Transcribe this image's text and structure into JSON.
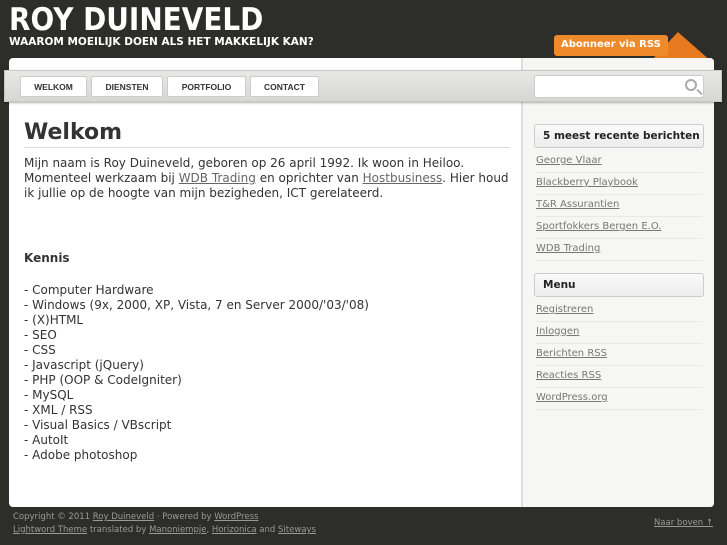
{
  "header": {
    "title": "ROY DUINEVELD",
    "tagline": "WAAROM MOEILIJK DOEN ALS HET MAKKELIJK KAN?",
    "rss": "Abonneer via RSS"
  },
  "nav": [
    "WELKOM",
    "DIENSTEN",
    "PORTFOLIO",
    "CONTACT"
  ],
  "search": {
    "placeholder": ""
  },
  "main": {
    "title": "Welkom",
    "intro_1": "Mijn naam is Roy Duineveld, geboren op 26 april 1992. Ik woon in Heiloo. Momenteel werkzaam bij ",
    "link_1": "WDB Trading",
    "intro_2": " en oprichter van ",
    "link_2": "Hostbusiness",
    "intro_3": ". Hier houd ik jullie op de hoogte van mijn bezigheden, ICT gerelateerd.",
    "kennis": "Kennis",
    "skills": [
      "- Computer Hardware",
      "- Windows (9x, 2000, XP, Vista, 7 en Server 2000/'03/'08)",
      "- (X)HTML",
      "- SEO",
      "- CSS",
      "- Javascript (jQuery)",
      "- PHP (OOP & CodeIgniter)",
      "- MySQL",
      "- XML / RSS",
      "- Visual Basics / VBscript",
      "- AutoIt",
      "- Adobe photoshop"
    ]
  },
  "sidebar": {
    "recent_title": "5 meest recente berichten",
    "recent": [
      "George Vlaar",
      "Blackberry Playbook",
      "T&R Assurantien",
      "Sportfokkers Bergen E.O.",
      "WDB Trading"
    ],
    "menu_title": "Menu",
    "menu": [
      "Registreren",
      "Inloggen",
      "Berichten RSS",
      "Reacties RSS",
      "WordPress.org"
    ]
  },
  "footer": {
    "copy": "Copyright © 2011 ",
    "author": "Roy Duineveld",
    "powered": " · Powered by ",
    "wp": "WordPress",
    "theme": "Lightword Theme",
    "translated": " translated by ",
    "t1": "Manoniempje",
    "comma": ", ",
    "t2": "Horizonica",
    "and": " and ",
    "t3": "Siteways",
    "top": "Naar boven ↑"
  }
}
